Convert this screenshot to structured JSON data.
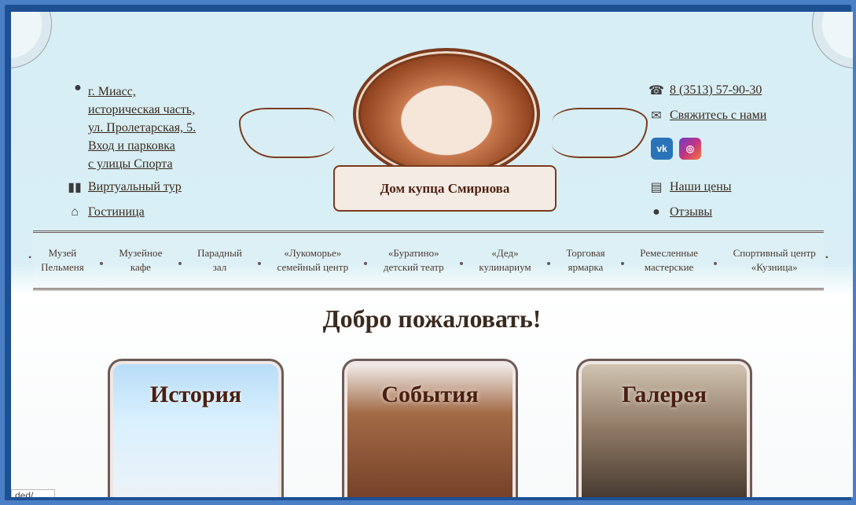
{
  "address": {
    "lines": [
      "г. Миасс,",
      "историческая часть,",
      "ул. Пролетарская, 5.",
      "Вход и парковка",
      "с улицы Спорта"
    ]
  },
  "left_links": {
    "virtual_tour": "Виртуальный тур",
    "hotel": "Гостиница"
  },
  "right_links": {
    "phone": "8 (3513) 57-90-30",
    "contact": "Свяжитесь с нами",
    "prices": "Наши цены",
    "reviews": "Отзывы"
  },
  "social": {
    "vk": "vk",
    "instagram": "instagram"
  },
  "logo": {
    "banner_text": "Дом купца Смирнова"
  },
  "menu": [
    {
      "l1": "Музей",
      "l2": "Пельменя"
    },
    {
      "l1": "Музейное",
      "l2": "кафе"
    },
    {
      "l1": "Парадный",
      "l2": "зал"
    },
    {
      "l1": "«Лукоморье»",
      "l2": "семейный центр"
    },
    {
      "l1": "«Буратино»",
      "l2": "детский театр"
    },
    {
      "l1": "«Дед»",
      "l2": "кулинариум"
    },
    {
      "l1": "Торговая",
      "l2": "ярмарка"
    },
    {
      "l1": "Ремесленные",
      "l2": "мастерские"
    },
    {
      "l1": "Спортивный центр",
      "l2": "«Кузница»"
    }
  ],
  "welcome": "Добро пожаловать!",
  "cards": [
    {
      "title": "История"
    },
    {
      "title": "События"
    },
    {
      "title": "Галерея"
    }
  ],
  "status_bar": {
    "text": "ded/"
  },
  "colors": {
    "brand_brown": "#7a3b1e",
    "bg_sky": "#d6eef4"
  },
  "icons": [
    "globe-icon",
    "map-icon",
    "home-icon",
    "phone-icon",
    "mail-icon",
    "vk-icon",
    "instagram-icon",
    "document-icon",
    "location-icon"
  ]
}
